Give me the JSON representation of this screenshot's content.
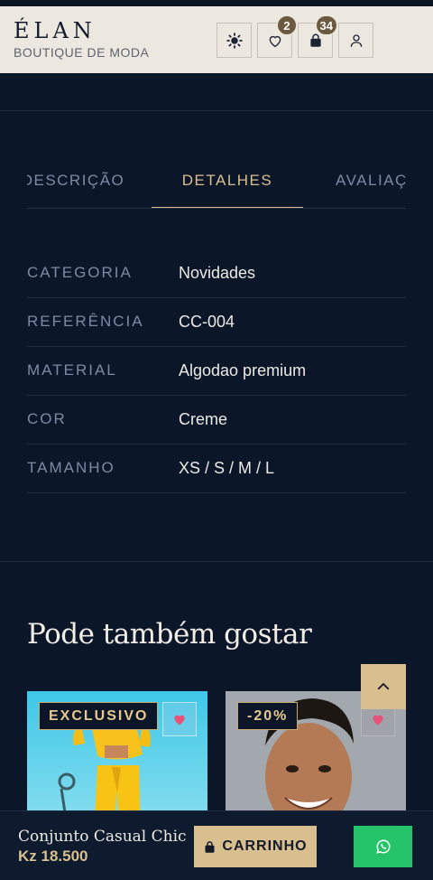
{
  "header": {
    "logo": "ÉLAN",
    "tagline": "BOUTIQUE DE MODA",
    "wishlist_count": "2",
    "cart_count": "34"
  },
  "tabs": [
    {
      "label": "DESCRIÇÃO",
      "active": false
    },
    {
      "label": "DETALHES",
      "active": true
    },
    {
      "label": "AVALIAÇÕES",
      "active": false
    }
  ],
  "details": [
    {
      "key": "CATEGORIA",
      "value": "Novidades"
    },
    {
      "key": "REFERÊNCIA",
      "value": "CC-004"
    },
    {
      "key": "MATERIAL",
      "value": "Algodao premium"
    },
    {
      "key": "COR",
      "value": "Creme"
    },
    {
      "key": "TAMANHO",
      "value": "XS / S / M / L"
    }
  ],
  "related": {
    "title": "Pode também gostar",
    "products": [
      {
        "tag": "EXCLUSIVO"
      },
      {
        "tag": "-20%"
      }
    ]
  },
  "bottom_bar": {
    "product_name": "Conjunto Casual Chic",
    "price": "Kz 18.500",
    "cart_label": "CARRINHO"
  },
  "colors": {
    "accent": "#d9bf8f",
    "background": "#0c1629",
    "header_bg": "#ece8e0",
    "whatsapp": "#25c46a",
    "favorite_heart": "#e8527a"
  }
}
